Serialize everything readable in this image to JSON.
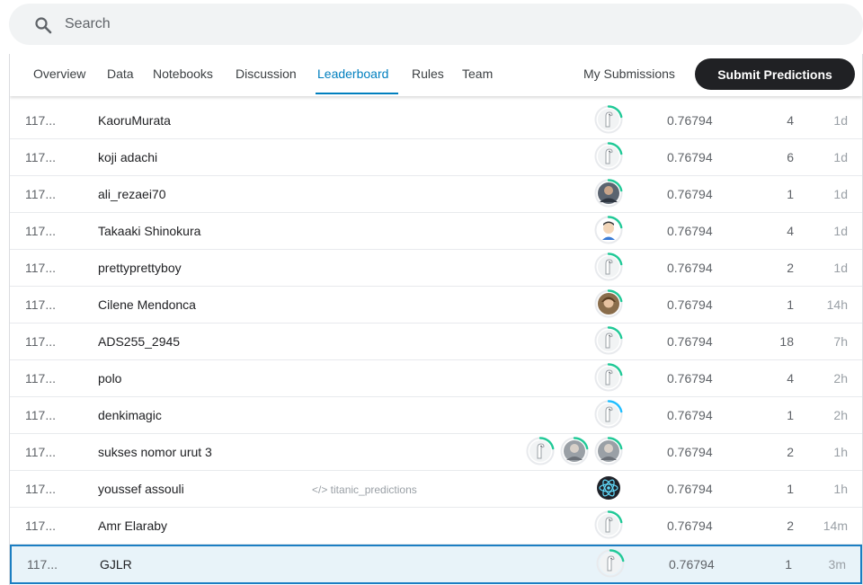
{
  "search": {
    "placeholder": "Search",
    "icon": "search-icon"
  },
  "tabs": [
    {
      "label": "Overview"
    },
    {
      "label": "Data"
    },
    {
      "label": "Notebooks"
    },
    {
      "label": "Discussion"
    },
    {
      "label": "Leaderboard",
      "active": true
    },
    {
      "label": "Rules"
    },
    {
      "label": "Team"
    }
  ],
  "actions": {
    "my_submissions": "My Submissions",
    "submit_predictions": "Submit Predictions"
  },
  "colors": {
    "accent": "#007fbf",
    "progress_green": "#20beff",
    "highlight_border": "#1b7ec2"
  },
  "rows": [
    {
      "rank": "117...",
      "name": "KaoruMurata",
      "kernel": "",
      "avatars": [
        "default"
      ],
      "score": "0.76794",
      "entries": "4",
      "last": "1d"
    },
    {
      "rank": "117...",
      "name": "koji adachi",
      "kernel": "",
      "avatars": [
        "default"
      ],
      "score": "0.76794",
      "entries": "6",
      "last": "1d"
    },
    {
      "rank": "117...",
      "name": "ali_rezaei70",
      "kernel": "",
      "avatars": [
        "photo-dark"
      ],
      "score": "0.76794",
      "entries": "1",
      "last": "1d"
    },
    {
      "rank": "117...",
      "name": "Takaaki Shinokura",
      "kernel": "",
      "avatars": [
        "photo-cartoon"
      ],
      "score": "0.76794",
      "entries": "4",
      "last": "1d"
    },
    {
      "rank": "117...",
      "name": "prettyprettyboy",
      "kernel": "",
      "avatars": [
        "default"
      ],
      "score": "0.76794",
      "entries": "2",
      "last": "1d"
    },
    {
      "rank": "117...",
      "name": "Cilene Mendonca",
      "kernel": "",
      "avatars": [
        "photo-woman"
      ],
      "score": "0.76794",
      "entries": "1",
      "last": "14h"
    },
    {
      "rank": "117...",
      "name": "ADS255_2945",
      "kernel": "",
      "avatars": [
        "default"
      ],
      "score": "0.76794",
      "entries": "18",
      "last": "7h"
    },
    {
      "rank": "117...",
      "name": "polo",
      "kernel": "",
      "avatars": [
        "default"
      ],
      "score": "0.76794",
      "entries": "4",
      "last": "2h"
    },
    {
      "rank": "117...",
      "name": "denkimagic",
      "kernel": "",
      "avatars": [
        "default-blue"
      ],
      "score": "0.76794",
      "entries": "1",
      "last": "2h"
    },
    {
      "rank": "117...",
      "name": "sukses nomor urut 3",
      "kernel": "",
      "avatars": [
        "default",
        "photo-gray",
        "photo-gray"
      ],
      "score": "0.76794",
      "entries": "2",
      "last": "1h"
    },
    {
      "rank": "117...",
      "name": "youssef assouli",
      "kernel": "</> titanic_predictions",
      "avatars": [
        "react-logo"
      ],
      "score": "0.76794",
      "entries": "1",
      "last": "1h"
    },
    {
      "rank": "117...",
      "name": "Amr Elaraby",
      "kernel": "",
      "avatars": [
        "default"
      ],
      "score": "0.76794",
      "entries": "2",
      "last": "14m"
    },
    {
      "rank": "117...",
      "name": "GJLR",
      "kernel": "",
      "avatars": [
        "default"
      ],
      "score": "0.76794",
      "entries": "1",
      "last": "3m",
      "highlight": true
    }
  ]
}
